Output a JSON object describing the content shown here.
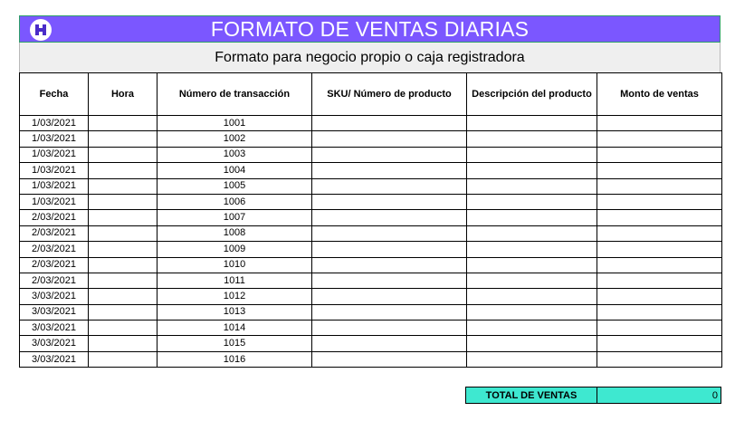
{
  "header": {
    "title": "FORMATO DE VENTAS DIARIAS",
    "subtitle": "Formato para negocio propio o caja registradora",
    "title_bg": "#7b57ff",
    "logo_icon": "brand-logo-icon"
  },
  "table": {
    "columns": [
      "Fecha",
      "Hora",
      "Número de transacción",
      "SKU/ Número de producto",
      "Descripción del producto",
      "Monto de ventas"
    ],
    "rows": [
      {
        "fecha": "1/03/2021",
        "hora": "",
        "transaccion": "1001",
        "sku": "",
        "descripcion": "",
        "monto": ""
      },
      {
        "fecha": "1/03/2021",
        "hora": "",
        "transaccion": "1002",
        "sku": "",
        "descripcion": "",
        "monto": ""
      },
      {
        "fecha": "1/03/2021",
        "hora": "",
        "transaccion": "1003",
        "sku": "",
        "descripcion": "",
        "monto": ""
      },
      {
        "fecha": "1/03/2021",
        "hora": "",
        "transaccion": "1004",
        "sku": "",
        "descripcion": "",
        "monto": ""
      },
      {
        "fecha": "1/03/2021",
        "hora": "",
        "transaccion": "1005",
        "sku": "",
        "descripcion": "",
        "monto": ""
      },
      {
        "fecha": "1/03/2021",
        "hora": "",
        "transaccion": "1006",
        "sku": "",
        "descripcion": "",
        "monto": ""
      },
      {
        "fecha": "2/03/2021",
        "hora": "",
        "transaccion": "1007",
        "sku": "",
        "descripcion": "",
        "monto": ""
      },
      {
        "fecha": "2/03/2021",
        "hora": "",
        "transaccion": "1008",
        "sku": "",
        "descripcion": "",
        "monto": ""
      },
      {
        "fecha": "2/03/2021",
        "hora": "",
        "transaccion": "1009",
        "sku": "",
        "descripcion": "",
        "monto": ""
      },
      {
        "fecha": "2/03/2021",
        "hora": "",
        "transaccion": "1010",
        "sku": "",
        "descripcion": "",
        "monto": ""
      },
      {
        "fecha": "2/03/2021",
        "hora": "",
        "transaccion": "1011",
        "sku": "",
        "descripcion": "",
        "monto": ""
      },
      {
        "fecha": "3/03/2021",
        "hora": "",
        "transaccion": "1012",
        "sku": "",
        "descripcion": "",
        "monto": ""
      },
      {
        "fecha": "3/03/2021",
        "hora": "",
        "transaccion": "1013",
        "sku": "",
        "descripcion": "",
        "monto": ""
      },
      {
        "fecha": "3/03/2021",
        "hora": "",
        "transaccion": "1014",
        "sku": "",
        "descripcion": "",
        "monto": ""
      },
      {
        "fecha": "3/03/2021",
        "hora": "",
        "transaccion": "1015",
        "sku": "",
        "descripcion": "",
        "monto": ""
      },
      {
        "fecha": "3/03/2021",
        "hora": "",
        "transaccion": "1016",
        "sku": "",
        "descripcion": "",
        "monto": ""
      }
    ]
  },
  "total": {
    "label": "TOTAL DE VENTAS",
    "value": "0",
    "bg": "#3ee8d0"
  }
}
